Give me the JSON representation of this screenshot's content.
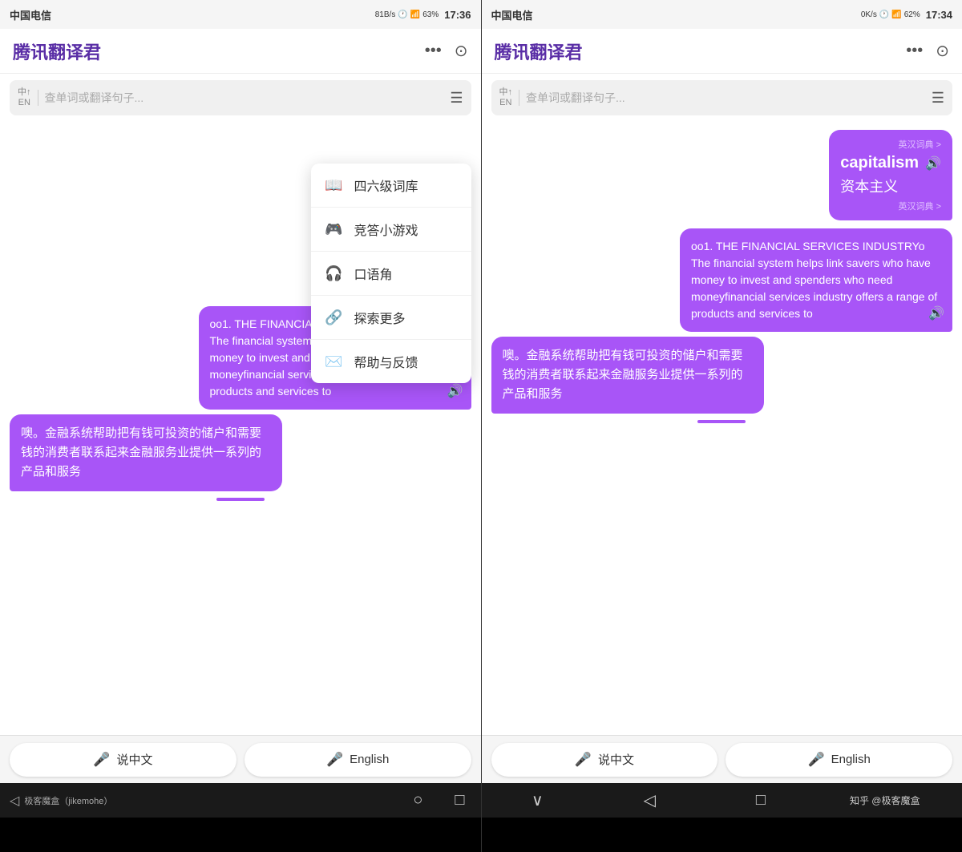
{
  "screen_left": {
    "status": {
      "carrier": "中国电信",
      "speed": "81B/s",
      "time": "17:36",
      "battery": "63%"
    },
    "header": {
      "title": "腾讯翻译君",
      "more_icon": "•••",
      "target_icon": "⊙"
    },
    "search": {
      "lang_from": "中↑",
      "lang_to": "EN",
      "placeholder": "查单词或翻译句子...",
      "menu_icon": "☰"
    },
    "dropdown": {
      "items": [
        {
          "icon": "📖",
          "label": "四六级词库"
        },
        {
          "icon": "🎮",
          "label": "竞答小游戏"
        },
        {
          "icon": "🎧",
          "label": "口语角"
        },
        {
          "icon": "🔍",
          "label": "探索更多"
        },
        {
          "icon": "✉️",
          "label": "帮助与反馈"
        }
      ]
    },
    "chat": {
      "bubble_english": "oo1. THE FINANCIAL SERVICES INDUSTRY\nThe financial system helps link savers who have money to invest and spenders who need moneyfinancial services industry offers a range of products and services to",
      "bubble_chinese": "噢。金融系统帮助把有钱可投资的储户和需要钱的消费者联系起来金融服务业提供一系列的产品和服务"
    },
    "bottom": {
      "chinese_btn": "说中文",
      "english_btn": "English"
    }
  },
  "screen_right": {
    "status": {
      "carrier": "中国电信",
      "speed": "0K/s",
      "time": "17:34",
      "battery": "62%"
    },
    "header": {
      "title": "腾讯翻译君",
      "more_icon": "•••",
      "target_icon": "⊙"
    },
    "search": {
      "lang_from": "中↑",
      "lang_to": "EN",
      "placeholder": "查单词或翻译句子...",
      "menu_icon": "☰"
    },
    "dict": {
      "link_top": "英汉词典 >",
      "word": "capitalism",
      "translation": "资本主义",
      "link_bottom": "英汉词典 >"
    },
    "chat": {
      "bubble_english": "oo1. THE FINANCIAL SERVICES INDUSTRYo\nThe financial system helps link savers who have money to invest and spenders who need moneyfinancial services industry offers a range of products and services to",
      "bubble_chinese": "噢。金融系统帮助把有钱可投资的储户和需要钱的消费者联系起来金融服务业提供一系列的产品和服务"
    },
    "bottom": {
      "chinese_btn": "说中文",
      "english_btn": "English"
    }
  },
  "nav_left": {
    "label": "极客魔盒（jikemohe）",
    "back": "◁",
    "home": "○",
    "recent": "□"
  },
  "nav_right": {
    "label": "知乎 @极客魔盒",
    "down": "∨",
    "back": "◁",
    "recent": "□"
  },
  "icons": {
    "mic": "🎤",
    "sound": "🔊",
    "book": "📖",
    "game": "🎮",
    "headphone": "🎧",
    "explore": "🔗",
    "mail": "✉"
  }
}
